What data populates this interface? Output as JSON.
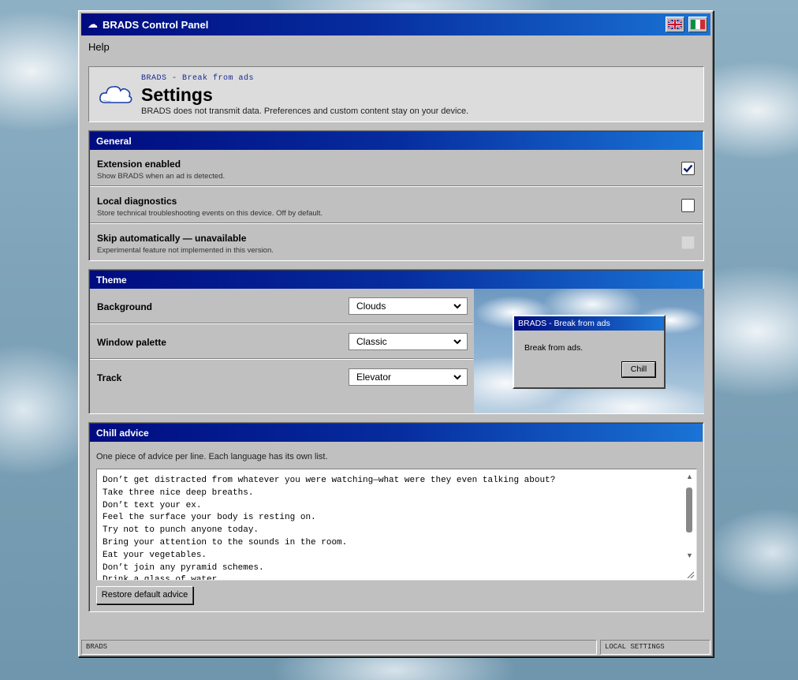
{
  "window": {
    "title": "BRADS Control Panel",
    "title_icon": "cloud-icon",
    "languages": [
      {
        "name": "uk-flag-icon"
      },
      {
        "name": "italy-flag-icon"
      }
    ]
  },
  "menu": {
    "help": "Help"
  },
  "header": {
    "kicker": "BRADS - Break from ads",
    "title": "Settings",
    "subtitle": "BRADS does not transmit data. Preferences and custom content stay on your device."
  },
  "general": {
    "heading": "General",
    "items": [
      {
        "label": "Extension enabled",
        "desc": "Show BRADS when an ad is detected.",
        "checked": true,
        "disabled": false
      },
      {
        "label": "Local diagnostics",
        "desc": "Store technical troubleshooting events on this device. Off by default.",
        "checked": false,
        "disabled": false
      },
      {
        "label": "Skip automatically — unavailable",
        "desc": "Experimental feature not implemented in this version.",
        "checked": false,
        "disabled": true
      }
    ]
  },
  "theme": {
    "heading": "Theme",
    "rows": [
      {
        "label": "Background",
        "value": "Clouds"
      },
      {
        "label": "Window palette",
        "value": "Classic"
      },
      {
        "label": "Track",
        "value": "Elevator"
      }
    ],
    "preview": {
      "window_title": "BRADS - Break from ads",
      "text": "Break from ads.",
      "button": "Chill"
    }
  },
  "advice": {
    "heading": "Chill advice",
    "desc": "One piece of advice per line. Each language has its own list.",
    "lines": [
      "Don’t get distracted from whatever you were watching—what were they even talking about?",
      "Take three nice deep breaths.",
      "Don’t text your ex.",
      "Feel the surface your body is resting on.",
      "Try not to punch anyone today.",
      "Bring your attention to the sounds in the room.",
      "Eat your vegetables.",
      "Don’t join any pyramid schemes.",
      "Drink a glass of water."
    ],
    "restore_button": "Restore default advice"
  },
  "status": {
    "left": "BRADS",
    "right": "LOCAL SETTINGS"
  },
  "colors": {
    "title_start": "#000c80",
    "title_end": "#1a74d6",
    "face": "#c0c0c0"
  }
}
